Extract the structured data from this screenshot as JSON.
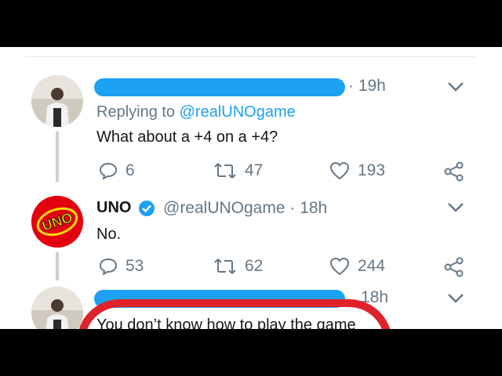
{
  "tweets": [
    {
      "time": "· 19h",
      "replying_prefix": "Replying to ",
      "replying_handle": "@realUNOgame",
      "text": "What about a +4 on a +4?",
      "replies": "6",
      "retweets": "47",
      "likes": "193"
    },
    {
      "name": "UNO",
      "handle_time": "@realUNOgame · 18h",
      "text": "No.",
      "replies": "53",
      "retweets": "62",
      "likes": "244",
      "avatar_logo": "UNO"
    },
    {
      "time": "18h",
      "text": "You don’t know how to play the game"
    }
  ],
  "colors": {
    "accent": "#1da1f2",
    "annotation_red": "#e0222a",
    "uno_red": "#e3000f",
    "muted": "#657786"
  },
  "icons": [
    "reply-icon",
    "retweet-icon",
    "like-icon",
    "share-icon",
    "chevron-down-icon",
    "verified-icon"
  ]
}
